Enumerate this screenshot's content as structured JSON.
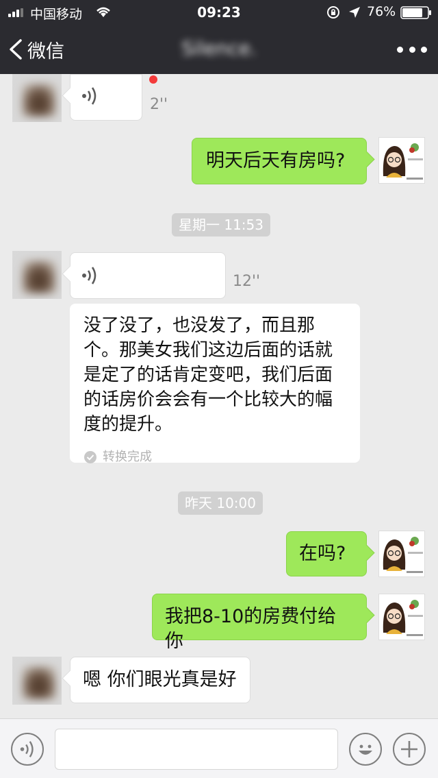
{
  "status_bar": {
    "carrier": "中国移动",
    "time": "09:23",
    "battery": "76%"
  },
  "nav": {
    "back_label": "微信",
    "title": "Silence."
  },
  "messages": [
    {
      "side": "left",
      "type": "voice",
      "duration": "2''",
      "unread": true
    },
    {
      "side": "right",
      "type": "text",
      "text": "明天后天有房吗?"
    },
    {
      "type": "timestamp",
      "text": "星期一 11:53"
    },
    {
      "side": "left",
      "type": "voice",
      "duration": "12''"
    },
    {
      "side": "left",
      "type": "transcript",
      "text": "没了没了，也没发了，而且那个。那美女我们这边后面的话就是定了的话肯定变吧，我们后面的话房价会会有一个比较大的幅度的提升。",
      "status": "转换完成"
    },
    {
      "type": "timestamp",
      "text": "昨天 10:00"
    },
    {
      "side": "right",
      "type": "text",
      "text": "在吗?"
    },
    {
      "side": "right",
      "type": "text",
      "text": "我把8-10的房费付给你"
    },
    {
      "side": "left",
      "type": "text",
      "text": "嗯 你们眼光真是好"
    }
  ],
  "input": {
    "value": "",
    "voice_icon": "voice-icon",
    "emoji_icon": "emoji-icon",
    "plus_icon": "plus-icon"
  },
  "colors": {
    "nav_bg": "#2b2b30",
    "chat_bg": "#ebebeb",
    "bubble_right": "#9ee85a",
    "bubble_left": "#ffffff",
    "unread_dot": "#f43a3a"
  }
}
